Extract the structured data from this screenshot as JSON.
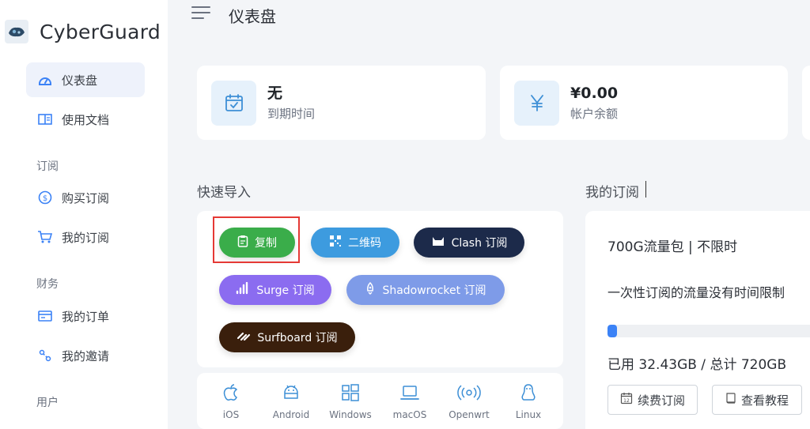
{
  "brand": {
    "name": "CyberGuard"
  },
  "sidebar": {
    "items": [
      {
        "label": "仪表盘",
        "icon": "dashboard-icon"
      },
      {
        "label": "使用文档",
        "icon": "book-icon"
      }
    ],
    "sections": [
      {
        "title": "订阅",
        "items": [
          {
            "label": "购买订阅",
            "icon": "dollar-icon"
          },
          {
            "label": "我的订阅",
            "icon": "cart-icon"
          }
        ]
      },
      {
        "title": "财务",
        "items": [
          {
            "label": "我的订单",
            "icon": "order-icon"
          },
          {
            "label": "我的邀请",
            "icon": "share-icon"
          }
        ]
      },
      {
        "title": "用户",
        "items": []
      }
    ]
  },
  "header": {
    "title": "仪表盘"
  },
  "stats": [
    {
      "value": "无",
      "label": "到期时间",
      "icon": "calendar-check-icon"
    },
    {
      "value": "¥0.00",
      "label": "帐户余额",
      "icon": "yen-icon"
    }
  ],
  "quick_import": {
    "title": "快速导入",
    "buttons": [
      {
        "label": "复制",
        "icon": "clipboard-icon",
        "color": "#3aad4a"
      },
      {
        "label": "二维码",
        "icon": "qrcode-icon",
        "color": "#3d9bdf"
      },
      {
        "label": "Clash 订阅",
        "icon": "clash-icon",
        "color": "#1c2a4a"
      },
      {
        "label": "Surge 订阅",
        "icon": "surge-icon",
        "color": "#8b6cf0"
      },
      {
        "label": "Shadowrocket 订阅",
        "icon": "rocket-icon",
        "color": "#7e9be8"
      },
      {
        "label": "Surfboard 订阅",
        "icon": "surfboard-icon",
        "color": "#3a1f0c"
      }
    ]
  },
  "platforms": [
    {
      "label": "iOS",
      "icon": "apple-icon"
    },
    {
      "label": "Android",
      "icon": "android-icon"
    },
    {
      "label": "Windows",
      "icon": "windows-icon"
    },
    {
      "label": "macOS",
      "icon": "laptop-icon"
    },
    {
      "label": "Openwrt",
      "icon": "broadcast-icon"
    },
    {
      "label": "Linux",
      "icon": "linux-icon"
    }
  ],
  "subscription": {
    "title": "我的订阅",
    "plan_name": "700G流量包 | 不限时",
    "description": "一次性订阅的流量没有时间限制",
    "usage_fraction": 0.045,
    "usage_text": "已用 32.43GB / 总计 720GB",
    "renew_label": "续费订阅",
    "tutorial_label": "查看教程"
  },
  "colors": {
    "accent": "#3b82f6",
    "highlight": "#e53935"
  }
}
